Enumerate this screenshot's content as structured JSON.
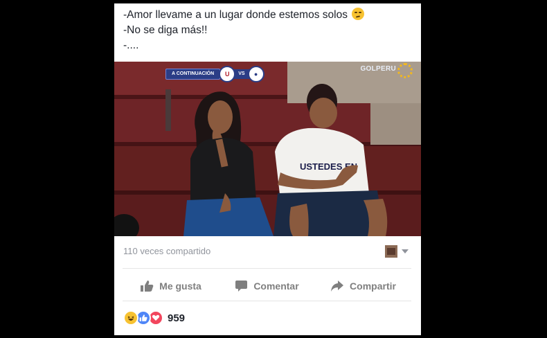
{
  "post": {
    "lines": [
      "-Amor llevame a un lugar donde estemos solos",
      "-No se diga más!!",
      "-...."
    ],
    "emoji": "smirk-emoji"
  },
  "photo": {
    "tv_banner": {
      "label": "A CONTINUACIÓN",
      "team_a": "U",
      "vs": "VS",
      "team_b": ""
    },
    "tv_logo": "GOLPERU",
    "shirt_text": "USTEDES EN"
  },
  "shares": {
    "text": "110 veces compartido"
  },
  "actions": {
    "like": "Me gusta",
    "comment": "Comentar",
    "share": "Compartir"
  },
  "reactions": {
    "types": [
      "haha-icon",
      "like-icon",
      "love-icon"
    ],
    "count": "959"
  },
  "colors": {
    "background": "#000000",
    "card": "#ffffff",
    "action_gray": "#7f7f7f",
    "like_blue": "#4f86f7",
    "love_red": "#f2465d",
    "haha_yellow": "#f7c231"
  }
}
